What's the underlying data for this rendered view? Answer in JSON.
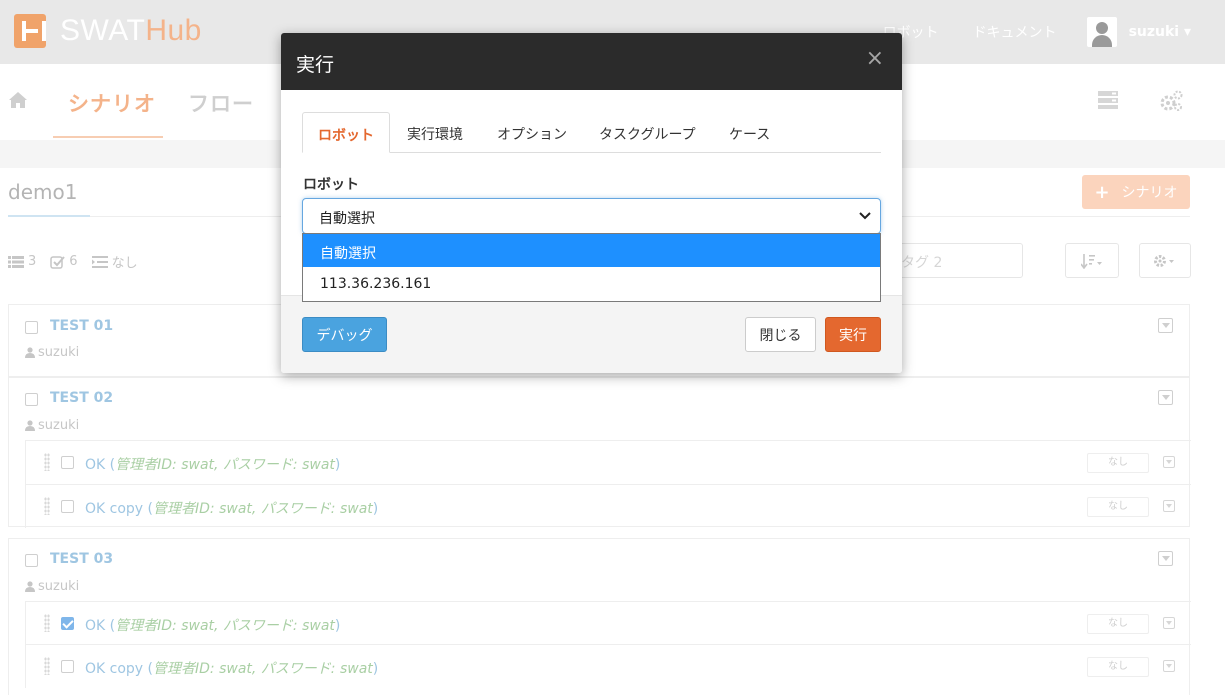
{
  "app": {
    "logo_main": "SWAT",
    "logo_accent": "Hub"
  },
  "nav": {
    "links": [
      "ロボット",
      "ドキュメント"
    ],
    "user": "suzuki ▾"
  },
  "subnav": {
    "tabs": [
      "シナリオ",
      "フロー"
    ],
    "active_tab": "シナリオ",
    "icons": [
      "home-icon",
      "server-icon",
      "settings-icon"
    ]
  },
  "project": {
    "title": "demo1",
    "add_button": "シナリオ",
    "stats": {
      "scenarios": "3",
      "cases": "6",
      "tags": "なし"
    },
    "tag_filter_placeholder": "タグ 2"
  },
  "scenarios": [
    {
      "title": "TEST 01",
      "author": "suzuki",
      "cases": []
    },
    {
      "title": "TEST 02",
      "author": "suzuki",
      "cases": [
        {
          "name": "OK",
          "params": "管理者ID: swat, パスワード: swat",
          "checked": false,
          "tag": "なし"
        },
        {
          "name": "OK copy",
          "params": "管理者ID: swat, パスワード: swat",
          "checked": false,
          "tag": "なし"
        }
      ]
    },
    {
      "title": "TEST 03",
      "author": "suzuki",
      "cases": [
        {
          "name": "OK",
          "params": "管理者ID: swat, パスワード: swat",
          "checked": true,
          "tag": "なし"
        },
        {
          "name": "OK copy",
          "params": "管理者ID: swat, パスワード: swat",
          "checked": false,
          "tag": "なし"
        }
      ]
    }
  ],
  "modal": {
    "title": "実行",
    "close": "×",
    "tabs": [
      "ロボット",
      "実行環境",
      "オプション",
      "タスクグループ",
      "ケース"
    ],
    "active_tab": "ロボット",
    "field_label": "ロボット",
    "select_value": "自動選択",
    "options": [
      "自動選択",
      "113.36.236.161"
    ],
    "selected_option": "自動選択",
    "buttons": {
      "debug": "デバッグ",
      "close": "閉じる",
      "run": "実行"
    }
  },
  "colors": {
    "accent": "#e4682f",
    "primary": "#4aa3df",
    "header_dark": "#2b2b2b",
    "option_highlight": "#1e90ff"
  }
}
